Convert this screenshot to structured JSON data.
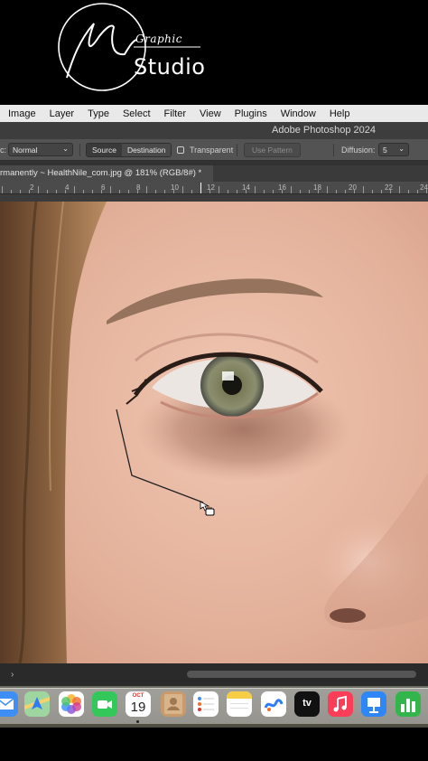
{
  "logo": {
    "graphic_text": "Graphic",
    "studio_text": "Studio"
  },
  "menubar": {
    "items": [
      "Image",
      "Layer",
      "Type",
      "Select",
      "Filter",
      "View",
      "Plugins",
      "Window",
      "Help"
    ]
  },
  "titlebar": {
    "title": "Adobe Photoshop 2024"
  },
  "options": {
    "mode_prefix": "c:",
    "mode_value": "Normal",
    "source_label": "Source",
    "destination_label": "Destination",
    "selected_mode": "Source",
    "transparent_label": "Transparent",
    "transparent_checked": false,
    "use_pattern_label": "Use Pattern",
    "diffusion_label": "Diffusion:",
    "diffusion_value": "5"
  },
  "document": {
    "tab_title": "rmanently ~ HealthNile_com.jpg @ 181% (RGB/8#) *"
  },
  "ruler": {
    "labels": [
      "2",
      "4",
      "6",
      "8",
      "10",
      "12",
      "14",
      "16",
      "18",
      "20",
      "22",
      "24"
    ]
  },
  "dock": {
    "apps": [
      "mail-icon",
      "maps-icon",
      "photos-icon",
      "facetime-icon",
      "calendar-icon",
      "contacts-icon",
      "reminders-icon",
      "notes-icon",
      "freeform-icon",
      "appletv-icon",
      "music-icon",
      "keynote-icon",
      "numbers-icon"
    ],
    "calendar_month": "OCT",
    "calendar_day": "19",
    "appletv_label": "tv"
  },
  "colors": {
    "menubar_bg": "#e9e9e9",
    "panel_bg": "#535353",
    "titlebar_bg": "#3d3d3d",
    "skin": "#e7b9a3"
  }
}
